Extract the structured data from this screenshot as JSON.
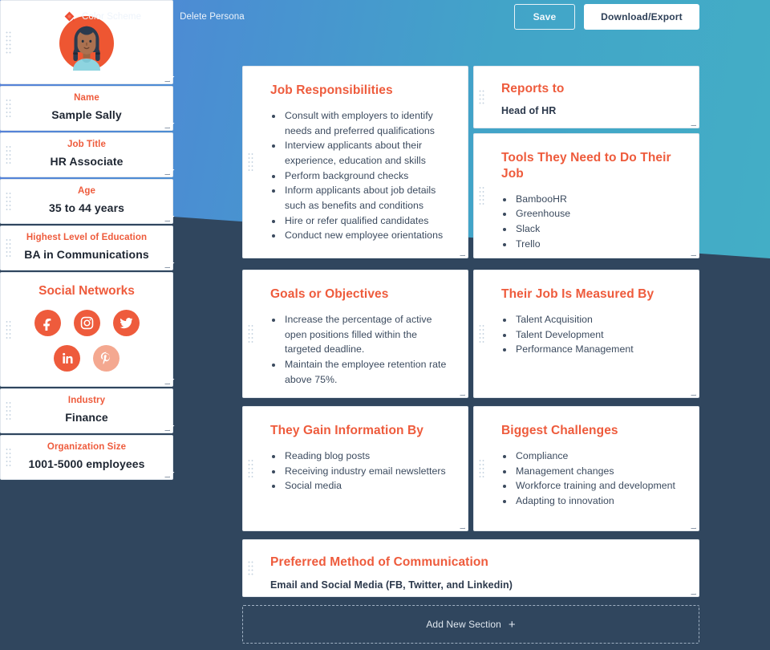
{
  "theme": {
    "accent": "#ee5b3c",
    "accent_muted": "#f4a890",
    "hero_gradient_from": "#5781d9",
    "hero_gradient_to": "#43aec6",
    "page_background": "#30465e",
    "card_background": "#ffffff",
    "body_text": "#3b4a5e"
  },
  "topbar": {
    "actions": [
      {
        "label": "Color Scheme",
        "icon": "color-palette-icon"
      },
      {
        "label": "Delete Persona",
        "icon": "trash-icon"
      }
    ],
    "save_label": "Save",
    "download_label": "Download/Export"
  },
  "profile": {
    "avatar": {
      "icon": "persona-avatar",
      "circle_color": "#ee5b3c",
      "hair_color": "#2b3a4e",
      "skin_color": "#a9724f",
      "shirt_color": "#8ed4e0"
    },
    "fields": [
      {
        "label": "Name",
        "value": "Sample Sally"
      },
      {
        "label": "Job Title",
        "value": "HR Associate"
      },
      {
        "label": "Age",
        "value": "35 to 44 years"
      },
      {
        "label": "Highest Level of Education",
        "value": "BA in Communications"
      }
    ],
    "social": {
      "title": "Social Networks",
      "rows": [
        [
          {
            "name": "facebook-icon",
            "active": true
          },
          {
            "name": "instagram-icon",
            "active": true
          },
          {
            "name": "twitter-icon",
            "active": true
          }
        ],
        [
          {
            "name": "linkedin-icon",
            "active": true
          },
          {
            "name": "pinterest-icon",
            "active": false
          }
        ]
      ]
    },
    "fields_after_social": [
      {
        "label": "Industry",
        "value": "Finance"
      },
      {
        "label": "Organization Size",
        "value": "1001-5000 employees"
      }
    ]
  },
  "sections": {
    "job_responsibilities": {
      "title": "Job Responsibilities",
      "items": [
        "Consult with employers to identify needs and preferred qualifications",
        "Interview applicants about their experience, education and skills",
        "Perform background checks",
        "Inform applicants about job details such as benefits and conditions",
        "Hire or refer qualified candidates",
        "Conduct new employee orientations"
      ]
    },
    "reports_to": {
      "title": "Reports to",
      "text": "Head of HR"
    },
    "tools": {
      "title": "Tools They Need to Do Their Job",
      "items": [
        "BambooHR",
        "Greenhouse",
        "Slack",
        "Trello"
      ]
    },
    "goals": {
      "title": "Goals or Objectives",
      "items": [
        "Increase the percentage of active open positions filled within the targeted deadline.",
        "Maintain the employee retention rate above 75%."
      ]
    },
    "measured_by": {
      "title": "Their Job Is Measured By",
      "items": [
        "Talent Acquisition",
        "Talent Development",
        "Performance Management"
      ]
    },
    "gain_information": {
      "title": "They Gain Information By",
      "items": [
        "Reading blog posts",
        "Receiving industry email newsletters",
        "Social media"
      ]
    },
    "challenges": {
      "title": "Biggest Challenges",
      "items": [
        "Compliance",
        "Management changes",
        "Workforce training and development",
        "Adapting to innovation"
      ]
    },
    "communication": {
      "title": "Preferred Method of Communication",
      "text": "Email and Social Media (FB, Twitter, and Linkedin)"
    }
  },
  "add_section": {
    "label": "Add New Section",
    "plus": "+"
  }
}
